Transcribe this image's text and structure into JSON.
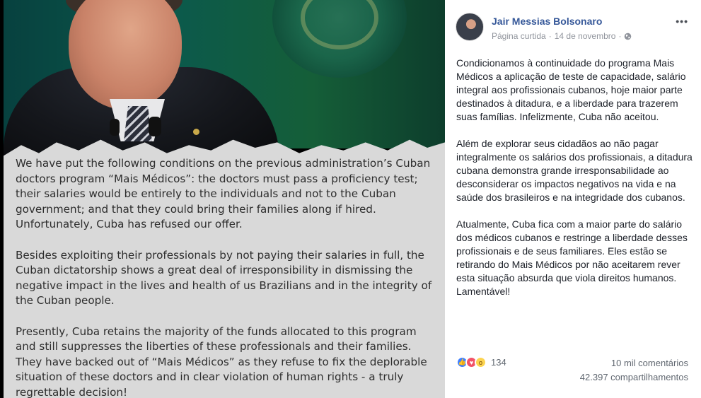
{
  "image": {
    "paragraphs": [
      "We have put the following conditions on the previous administration’s Cuban doctors program “Mais Médicos”: the doctors must pass a proficiency test; their salaries would be entirely to the individuals and not to the Cuban government; and that they could bring their families along if hired. Unfortunately, Cuba has refused our offer.",
      "Besides exploiting their professionals by not paying their salaries in full, the Cuban dictatorship shows a great deal of irresponsibility in dismissing the negative impact in the lives and health of us Brazilians and in  the integrity of the Cuban people.",
      "Presently, Cuba retains the majority of the funds allocated to this program and still suppresses the liberties of these professionals and their families. They have backed out of “Mais Médicos” as they refuse to fix the deplorable situation of these doctors and in clear violation of human rights - a truly regrettable decision!"
    ]
  },
  "post": {
    "author": "Jair Messias Bolsonaro",
    "page_type": "Página curtida",
    "separator": "·",
    "date": "14 de novembro",
    "more_label": "•••",
    "paragraphs": [
      "Condicionamos à continuidade do programa Mais Médicos a aplicação de teste de capacidade, salário integral aos profissionais cubanos, hoje maior parte destinados à ditadura, e a liberdade para trazerem suas famílias. Infelizmente, Cuba não aceitou.",
      "Além de explorar seus cidadãos ao não pagar integralmente os salários dos profissionais, a ditadura cubana demonstra grande irresponsabilidade ao desconsiderar os impactos negativos na vida e na saúde dos brasileiros e na integridade dos cubanos.",
      "Atualmente, Cuba fica com a maior parte do salário dos médicos cubanos e restringe a liberdade desses profissionais e de seus familiares. Eles estão se retirando do Mais Médicos por não aceitarem rever esta situação absurda que viola direitos humanos. Lamentável!"
    ],
    "reactions": {
      "icons": [
        "like-icon",
        "love-icon",
        "wow-icon"
      ],
      "count": "134"
    },
    "comments": "10 mil comentários",
    "shares": "42.397 compartilhamentos"
  },
  "colors": {
    "link": "#365899",
    "meta": "#90949c",
    "like": "#4080ff",
    "love": "#f25268",
    "wow": "#fcd450"
  }
}
